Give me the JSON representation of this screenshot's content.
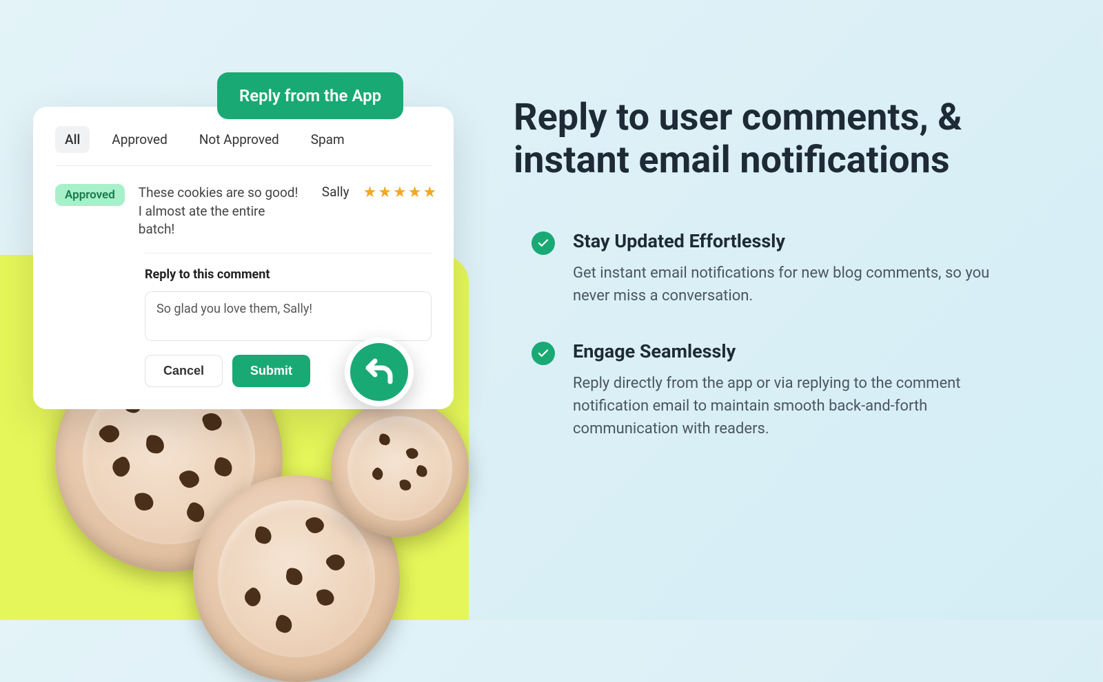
{
  "header_pill": "Reply from the App",
  "tabs": [
    "All",
    "Approved",
    "Not Approved",
    "Spam"
  ],
  "active_tab_index": 0,
  "comment": {
    "status": "Approved",
    "text": "These cookies are so good! I almost ate the entire batch!",
    "author": "Sally",
    "stars": 5
  },
  "reply": {
    "label": "Reply to this comment",
    "draft": "So glad you love them, Sally!",
    "cancel": "Cancel",
    "submit": "Submit"
  },
  "headline": "Reply to user comments, & instant email notifications",
  "features": [
    {
      "title": "Stay Updated Effortlessly",
      "desc": "Get instant email notifications for new blog comments, so you never miss a conversation."
    },
    {
      "title": "Engage Seamlessly",
      "desc": "Reply directly from the app or via replying to the comment notification email to maintain smooth back-and-forth communication with readers."
    }
  ]
}
